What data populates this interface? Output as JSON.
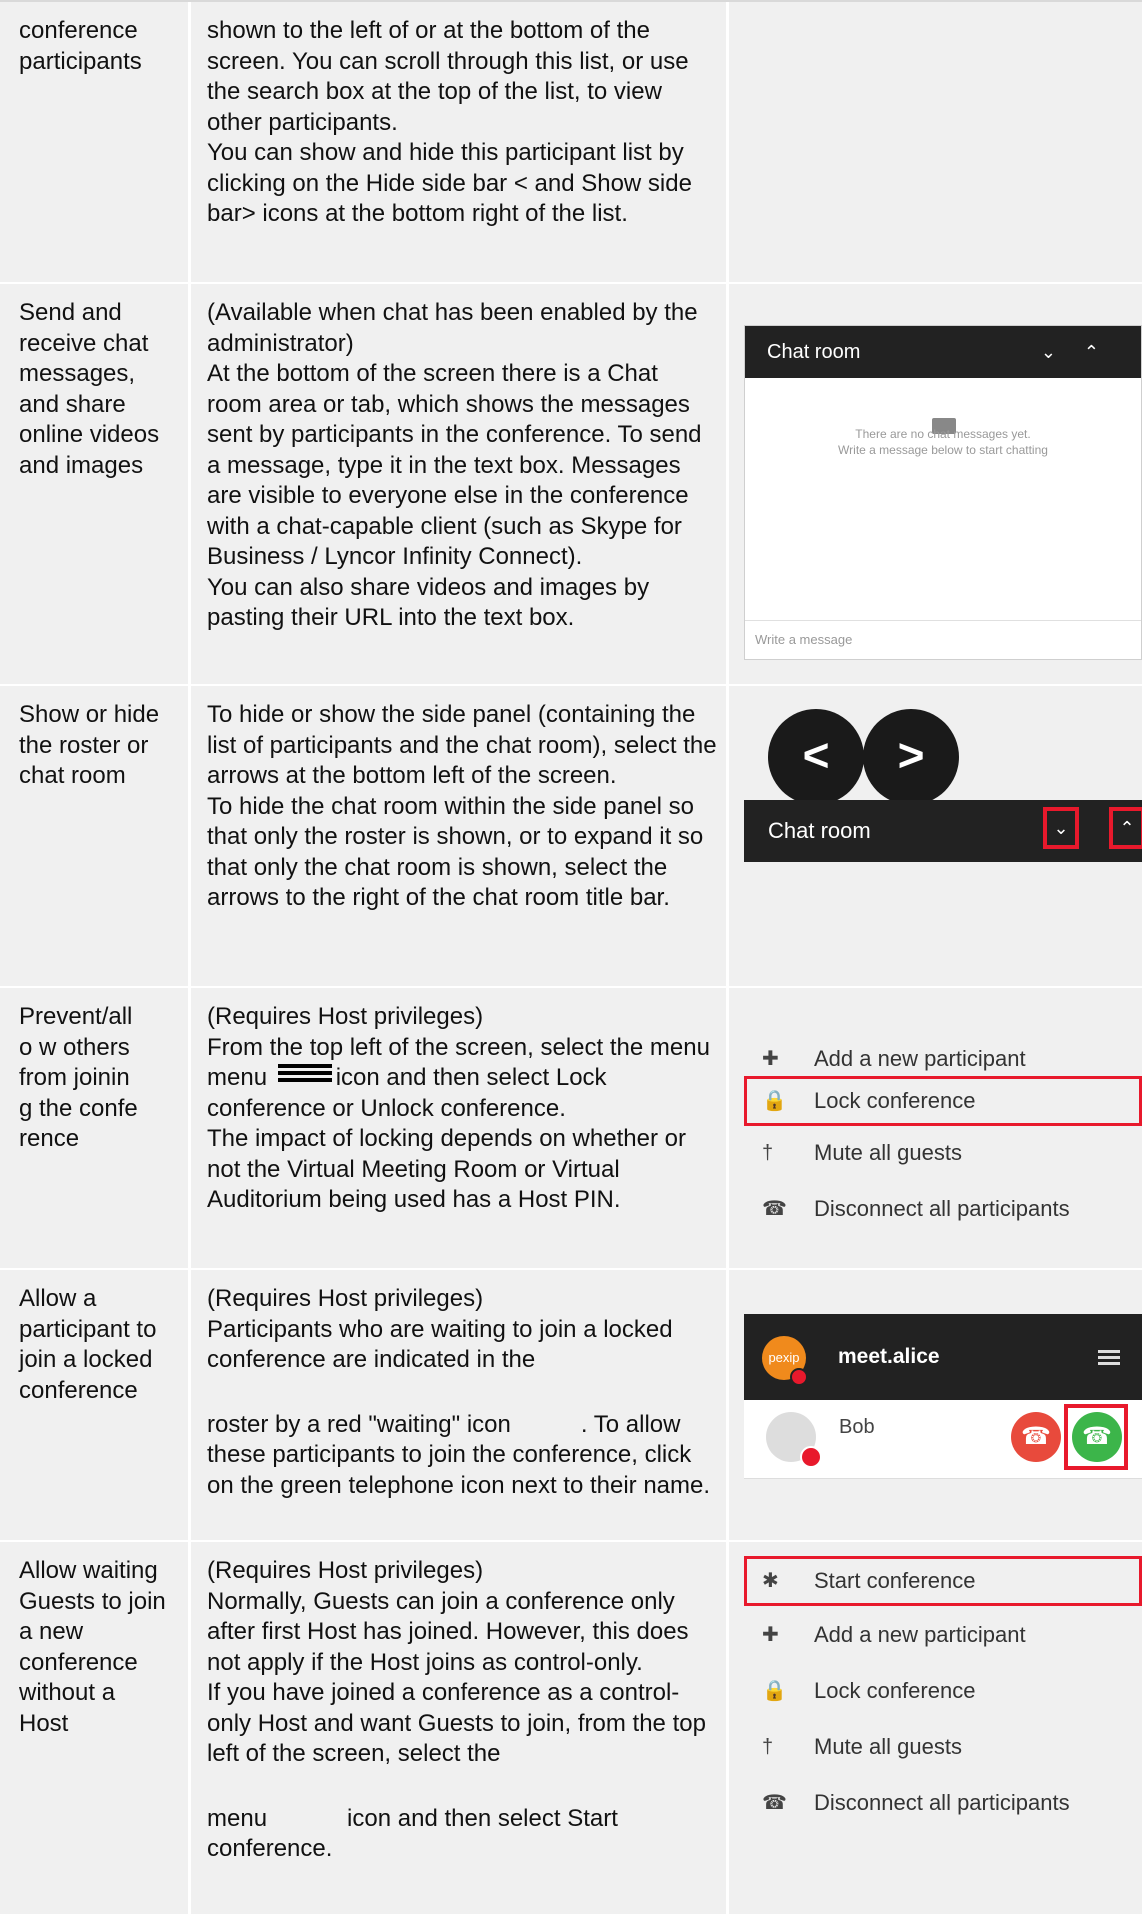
{
  "rows": [
    {
      "feature": "conference participants",
      "description": [
        "shown to the left of or at the bottom of the screen. You can scroll through this list, or use the search box at the top of the list, to view other participants.",
        "You can show and hide this participant list by clicking on the Hide side bar < and Show side bar> icons at the bottom right of the list."
      ]
    },
    {
      "feature": "Send and receive chat messages, and share online videos and images",
      "description": [
        "(Available when chat has been enabled by the administrator)",
        "At the bottom of the screen there is a Chat room area or tab, which shows the messages sent by participants in the conference. To send a message, type it in the text box. Messages are visible to everyone else in the conference with a chat-capable client (such as Skype for Business / Lyncor Infinity Connect).",
        "You can also share videos and images by pasting their URL into the text box."
      ],
      "screenshot": {
        "title": "Chat room",
        "empty_line1": "There are no chat messages yet.",
        "empty_line2": "Write a message below to start chatting",
        "input_placeholder": "Write a message"
      }
    },
    {
      "feature": "Show or hide the roster or chat room",
      "description": [
        "To hide or show the side panel (containing the list of participants and the chat room), select the arrows at the bottom left of the screen.",
        "To hide the chat room within the side panel so that only the roster is shown, or to expand it so that only the chat room is shown, select the arrows to the right of the chat room title bar."
      ],
      "screenshot": {
        "title": "Chat room",
        "left_arrow": "<",
        "right_arrow": ">"
      }
    },
    {
      "feature": "Prevent/allo w others from joining the conference",
      "description": [
        "(Requires Host privileges)",
        "From the top left of the screen, select the menu",
        "icon and then select Lock conference or Unlock conference.",
        "The impact of locking depends on whether or not the Virtual Meeting Room or Virtual Auditorium being used has a Host PIN."
      ],
      "menu": [
        "Add a new participant",
        "Lock conference",
        "Mute all guests",
        "Disconnect all participants"
      ]
    },
    {
      "feature": "Allow a participant to join a locked conference",
      "description": [
        "(Requires Host privileges)",
        "Participants who are waiting to join a locked conference are indicated in the",
        "roster by a red \"waiting\" icon",
        ". To allow these participants to join the conference, click on the green telephone icon next to their name."
      ],
      "screenshot": {
        "room": "meet.alice",
        "avatar_text": "pexip",
        "participant": "Bob"
      }
    },
    {
      "feature": "Allow waiting Guests to join a new conference without a Host",
      "description": [
        "(Requires Host privileges)",
        "Normally, Guests can join a conference only after first Host has joined. However, this does not apply if the Host joins as control-only.",
        "If you have joined a conference as a control-only Host and want Guests to join, from the top left of the screen, select the",
        "menu",
        "icon and then select Start conference."
      ],
      "menu": [
        "Start conference",
        "Add a new participant",
        "Lock conference",
        "Mute all guests",
        "Disconnect all participants"
      ]
    }
  ]
}
